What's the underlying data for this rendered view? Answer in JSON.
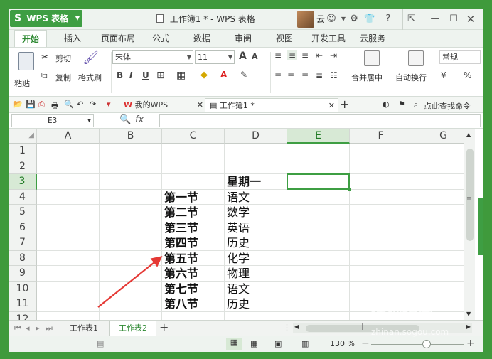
{
  "app": {
    "menu_button": "WPS 表格",
    "document_title": "工作簿1 * - WPS 表格",
    "user": "云",
    "window_controls": [
      "最小化",
      "最大化",
      "关闭"
    ]
  },
  "ribbon_tabs": [
    {
      "label": "开始",
      "active": true
    },
    {
      "label": "插入"
    },
    {
      "label": "页面布局"
    },
    {
      "label": "公式"
    },
    {
      "label": "数据"
    },
    {
      "label": "审阅"
    },
    {
      "label": "视图"
    },
    {
      "label": "开发工具"
    },
    {
      "label": "云服务"
    }
  ],
  "ribbon": {
    "paste": "粘贴",
    "cut": "剪切",
    "copy": "复制",
    "format_painter": "格式刷",
    "font_name": "宋体",
    "font_size": "11",
    "font_grow": "A",
    "font_shrink": "A",
    "bold": "B",
    "italic": "I",
    "underline": "U",
    "merge_center": "合并居中",
    "wrap_text": "自动换行",
    "number_format": "常规",
    "percent": "%"
  },
  "quick_bar": {
    "doc_tabs": [
      {
        "label": "我的WPS"
      },
      {
        "label": "工作簿1 *",
        "active": true
      }
    ],
    "search_placeholder": "点此查找命令"
  },
  "formula_bar": {
    "name_box": "E3",
    "fx": "fx",
    "value": ""
  },
  "sheet": {
    "columns": [
      "A",
      "B",
      "C",
      "D",
      "E",
      "F",
      "G"
    ],
    "rows": [
      "1",
      "2",
      "3",
      "4",
      "5",
      "6",
      "7",
      "8",
      "9",
      "10",
      "11",
      "12"
    ],
    "selected_cell": "E3",
    "cells": {
      "D3": "星期一",
      "C4": "第一节",
      "D4": "语文",
      "C5": "第二节",
      "D5": "数学",
      "C6": "第三节",
      "D6": "英语",
      "C7": "第四节",
      "D7": "历史",
      "C8": "第五节",
      "D8": "化学",
      "C9": "第六节",
      "D9": "物理",
      "C10": "第七节",
      "D10": "语文",
      "C11": "第八节",
      "D11": "历史"
    },
    "bold_cells": [
      "D3",
      "C4",
      "C5",
      "C6",
      "C7",
      "C8",
      "C9",
      "C10",
      "C11"
    ]
  },
  "sheet_tabs": [
    {
      "label": "工作表1"
    },
    {
      "label": "工作表2",
      "active": true
    }
  ],
  "status": {
    "zoom": "130 %"
  },
  "watermark": {
    "brand": "搜狗指南",
    "url": "zhinan.sogou.com"
  },
  "colors": {
    "accent": "#3e9e43",
    "arrow": "#e53935"
  }
}
